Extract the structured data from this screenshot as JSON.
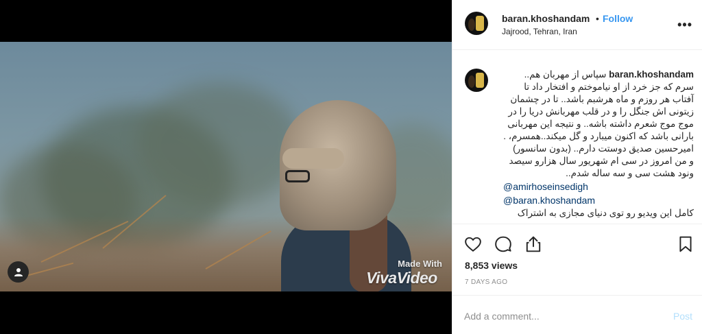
{
  "media": {
    "watermark_small": "Made With",
    "watermark_big": "VivaVideo"
  },
  "header": {
    "username": "baran.khoshandam",
    "separator": "•",
    "follow_label": "Follow",
    "location": "Jajrood, Tehran, Iran",
    "more_icon": "more-horizontal-icon"
  },
  "caption": {
    "username": "baran.khoshandam",
    "text": "سپاس از مهربان هم.. سرم که جز خرد از او نیاموختم و افتخار داد تا آفتاب هر روزم و ماه هرشبم باشد.. تا در چشمان زیتونی اش جنگل را و در قلب مهربانش دریا را در موج موج شعرم داشته باشه.. و نتیجه این مهربانی بارانی باشد که اکنون میبارد و گل میکند..همسرم، . امیرحسین صدیق دوستت دارم.. (بدون سانسور)\nو من امروز در سی ام شهریور سال هزارو سیصد ونود هشت سی و سه ساله شدم..",
    "mentions": [
      "@amirhoseinsedigh",
      "@baran.khoshandam"
    ],
    "cut_line": "کامل این ویدیو رو توی دنیای مجازی به اشتراک"
  },
  "actions": {
    "like_icon": "heart-icon",
    "comment_icon": "comment-icon",
    "share_icon": "share-icon",
    "save_icon": "bookmark-icon",
    "views": "8,853 views",
    "time": "7 DAYS AGO"
  },
  "comment": {
    "placeholder": "Add a comment...",
    "post_label": "Post"
  },
  "colors": {
    "link": "#3897f0",
    "post_disabled": "#b2dffc",
    "mention": "#003569",
    "muted": "#8e8e8e"
  }
}
